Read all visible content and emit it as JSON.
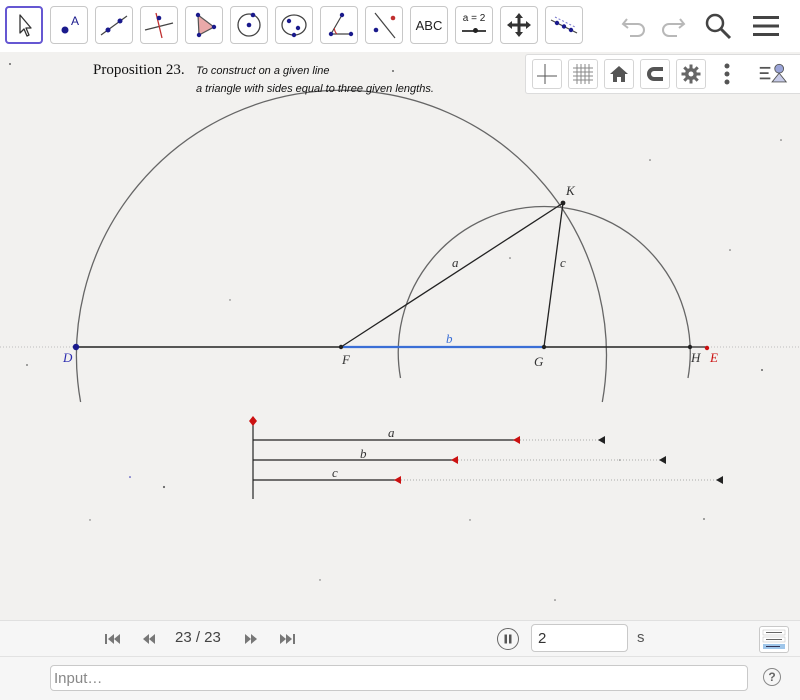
{
  "toolbar": {
    "tools": [
      {
        "name": "move-tool",
        "icon": "pointer-arrow-icon",
        "active": true
      },
      {
        "name": "point-tool",
        "icon": "point-icon"
      },
      {
        "name": "line-tool",
        "icon": "line-through-two-points-icon"
      },
      {
        "name": "perpendicular-tool",
        "icon": "perpendicular-line-icon"
      },
      {
        "name": "polygon-tool",
        "icon": "polygon-icon"
      },
      {
        "name": "circle-tool",
        "icon": "circle-center-point-icon"
      },
      {
        "name": "ellipse-tool",
        "icon": "conic-ellipse-icon"
      },
      {
        "name": "angle-tool",
        "icon": "angle-icon"
      },
      {
        "name": "reflect-tool",
        "icon": "reflect-about-line-icon"
      },
      {
        "name": "text-tool",
        "icon": "text-icon",
        "label": "ABC"
      },
      {
        "name": "slider-tool",
        "icon": "slider-icon",
        "label": "a = 2"
      },
      {
        "name": "move-graphics-tool",
        "icon": "move-graphics-view-icon"
      },
      {
        "name": "custom-tool",
        "icon": "custom-tool-icon"
      }
    ],
    "undo_icon": "undo-icon",
    "redo_icon": "redo-icon",
    "search_icon": "search-icon",
    "menu_icon": "hamburger-menu-icon"
  },
  "stylebar": {
    "buttons": [
      "axes-icon",
      "grid-icon",
      "home-icon",
      "magnet-icon",
      "gear-icon",
      "more-vertical-icon",
      "view-menu-icon"
    ]
  },
  "proposition": {
    "title": "Proposition 23.",
    "line1": "To construct on a given line",
    "line2": "a triangle with sides equal to three given lengths."
  },
  "labels": {
    "D": "D",
    "F": "F",
    "G": "G",
    "H": "H",
    "E": "E",
    "K": "K",
    "seg_a": "a",
    "seg_b": "b",
    "seg_c": "c",
    "given_a": "a",
    "given_b": "b",
    "given_c": "c"
  },
  "colors": {
    "accent": "#6557d2",
    "point_blue": "#1a1a8c",
    "label_blue": "#2b2bb0",
    "red": "#cc1111",
    "segment_b": "#3b6fd6",
    "canvas_bg": "#f2f1ef"
  },
  "animation": {
    "step_counter": "23 / 23",
    "speed_value": "2",
    "speed_unit": "s",
    "first_icon": "skip-first-icon",
    "prev_icon": "step-back-icon",
    "next_icon": "step-forward-icon",
    "last_icon": "skip-last-icon",
    "pause_icon": "pause-icon",
    "algebra_icon": "algebra-view-icon"
  },
  "input_bar": {
    "placeholder": "Input…",
    "help_icon": "help-icon",
    "help_label": "?"
  }
}
